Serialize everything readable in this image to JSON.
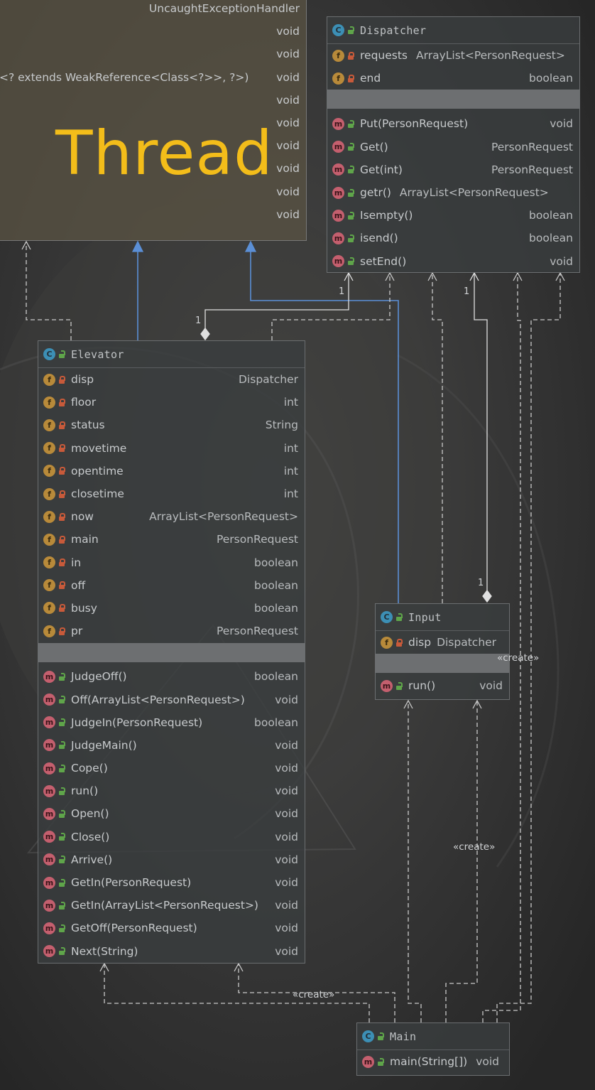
{
  "watermark": "Thread",
  "thread": {
    "rows": [
      {
        "name": "",
        "type": "UncaughtExceptionHandler"
      },
      {
        "name": "",
        "type": "void"
      },
      {
        "name": "",
        "type": "void"
      },
      {
        "name": "<? extends WeakReference<Class<?>>, ?>)",
        "type": "void"
      },
      {
        "name": "",
        "type": "void"
      },
      {
        "name": "",
        "type": "void"
      },
      {
        "name": "",
        "type": "void"
      },
      {
        "name": "",
        "type": "void"
      },
      {
        "name": "",
        "type": "void"
      },
      {
        "name": "",
        "type": "void"
      }
    ]
  },
  "dispatcher": {
    "name": "Dispatcher",
    "fields": [
      {
        "name": "requests",
        "type": "ArrayList<PersonRequest>",
        "vis": "private"
      },
      {
        "name": "end",
        "type": "boolean",
        "vis": "private"
      }
    ],
    "methods": [
      {
        "name": "Put(PersonRequest)",
        "type": "void"
      },
      {
        "name": "Get()",
        "type": "PersonRequest"
      },
      {
        "name": "Get(int)",
        "type": "PersonRequest"
      },
      {
        "name": "getr()",
        "type": "ArrayList<PersonRequest>"
      },
      {
        "name": "Isempty()",
        "type": "boolean"
      },
      {
        "name": "isend()",
        "type": "boolean"
      },
      {
        "name": "setEnd()",
        "type": "void"
      }
    ]
  },
  "elevator": {
    "name": "Elevator",
    "fields": [
      {
        "name": "disp",
        "type": "Dispatcher"
      },
      {
        "name": "floor",
        "type": "int"
      },
      {
        "name": "status",
        "type": "String"
      },
      {
        "name": "movetime",
        "type": "int"
      },
      {
        "name": "opentime",
        "type": "int"
      },
      {
        "name": "closetime",
        "type": "int"
      },
      {
        "name": "now",
        "type": "ArrayList<PersonRequest>"
      },
      {
        "name": "main",
        "type": "PersonRequest"
      },
      {
        "name": "in",
        "type": "boolean"
      },
      {
        "name": "off",
        "type": "boolean"
      },
      {
        "name": "busy",
        "type": "boolean"
      },
      {
        "name": "pr",
        "type": "PersonRequest"
      }
    ],
    "methods": [
      {
        "name": "JudgeOff()",
        "type": "boolean"
      },
      {
        "name": "Off(ArrayList<PersonRequest>)",
        "type": "void"
      },
      {
        "name": "JudgeIn(PersonRequest)",
        "type": "boolean"
      },
      {
        "name": "JudgeMain()",
        "type": "void"
      },
      {
        "name": "Cope()",
        "type": "void"
      },
      {
        "name": "run()",
        "type": "void"
      },
      {
        "name": "Open()",
        "type": "void"
      },
      {
        "name": "Close()",
        "type": "void"
      },
      {
        "name": "Arrive()",
        "type": "void"
      },
      {
        "name": "GetIn(PersonRequest)",
        "type": "void"
      },
      {
        "name": "GetIn(ArrayList<PersonRequest>)",
        "type": "void"
      },
      {
        "name": "GetOff(PersonRequest)",
        "type": "void"
      },
      {
        "name": "Next(String)",
        "type": "void"
      }
    ]
  },
  "input": {
    "name": "Input",
    "fields": [
      {
        "name": "disp",
        "type": "Dispatcher"
      }
    ],
    "methods": [
      {
        "name": "run()",
        "type": "void"
      }
    ]
  },
  "main": {
    "name": "Main",
    "methods": [
      {
        "name": "main(String[])",
        "type": "void"
      }
    ]
  },
  "labels": {
    "create_input": "«create»",
    "create_mid": "«create»",
    "create_bottom": "«create»",
    "mult_dispatcher_elevator": "1",
    "mult_elevator": "1",
    "mult_dispatcher_input": "1",
    "mult_input": "1"
  },
  "colors": {
    "background": "#2b2b2b",
    "inheritance_line": "#5b8fd6",
    "dependency_line": "#c9c9c9",
    "watermark": "#f3bd1a"
  }
}
